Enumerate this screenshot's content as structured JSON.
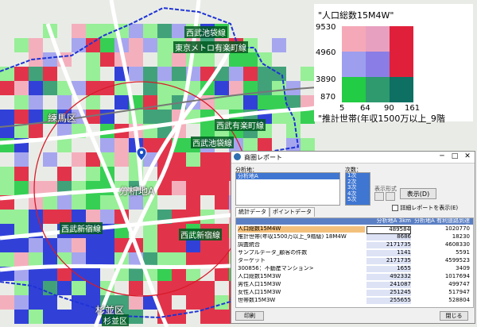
{
  "map": {
    "labels": [
      {
        "key": "nerima",
        "text": "練馬区"
      },
      {
        "key": "suginami",
        "text": "杉並区"
      },
      {
        "key": "area",
        "text": "分析地A"
      }
    ],
    "tags": [
      {
        "key": "t1",
        "text": "西武池袋線"
      },
      {
        "key": "t2",
        "text": "東京メトロ有楽町線"
      },
      {
        "key": "t3",
        "text": "西武有楽町線"
      },
      {
        "key": "t4",
        "text": "西武池袋線"
      },
      {
        "key": "t5",
        "text": "西武新宿線"
      },
      {
        "key": "t6",
        "text": "西武新宿線"
      },
      {
        "key": "t7",
        "text": "杉並区"
      }
    ]
  },
  "legend": {
    "title_y": "\"人口総数15M4W\"",
    "title_x": "\"推計世帯(年収1500万以上_9階",
    "y_ticks": [
      "9530",
      "4960",
      "3890",
      "870"
    ],
    "x_ticks": [
      "5",
      "64",
      "90",
      "161"
    ],
    "colors": [
      [
        "#f5a9b8",
        "#e8a0c0",
        "#e0203a"
      ],
      [
        "#9e9eef",
        "#8a7ee6",
        "#e0203a"
      ],
      [
        "#22cc44",
        "#2f9a6e",
        "#0e6f63"
      ]
    ]
  },
  "window": {
    "title": "商圏レポート",
    "minimize": "─",
    "maximize": "□",
    "close": "✕",
    "area_label": "分析地：",
    "area_item": "分析地A",
    "level_label": "次数：",
    "levels": [
      "1次",
      "2次",
      "3次",
      "4次",
      "5次"
    ],
    "display_type": "表示形式",
    "display_button": "表示(D)",
    "detail_checkbox": "詳細レポートを表示(E)",
    "tabs": [
      "統計データ",
      "ポイントデータ"
    ],
    "col_headers": [
      "",
      "分析地A 3km",
      "分析地A 有利道路到達15分"
    ],
    "rows": [
      {
        "name": "人口総数15M4W",
        "v1": "489584",
        "v2": "1020770"
      },
      {
        "name": "推計世帯(年収1500万以上_9階級) 18M4W",
        "v1": "8686",
        "v2": "18230"
      },
      {
        "name": "調査統合",
        "v1": "2171735",
        "v2": "4608330"
      },
      {
        "name": "サンプルデータ_顧客の件数",
        "v1": "1141",
        "v2": "5591"
      },
      {
        "name": "ターゲット",
        "v1": "2171735",
        "v2": "4599523"
      },
      {
        "name": "300856：不動産マンション>",
        "v1": "1655",
        "v2": "3409"
      },
      {
        "name": "人口総数15M3W",
        "v1": "492332",
        "v2": "1017694"
      },
      {
        "name": "男性人口15M3W",
        "v1": "241087",
        "v2": "499747"
      },
      {
        "name": "女性人口15M3W",
        "v1": "251245",
        "v2": "517947"
      },
      {
        "name": "世帯数15M3W",
        "v1": "255655",
        "v2": "528804"
      }
    ],
    "print_button": "印刷",
    "close_button": "閉じる"
  }
}
